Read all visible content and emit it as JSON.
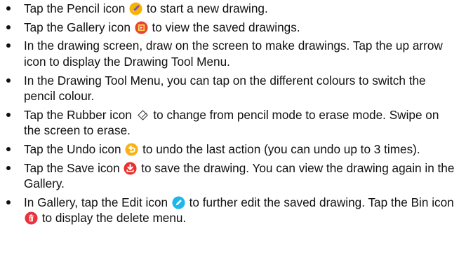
{
  "items": [
    {
      "before": "Tap the Pencil icon",
      "icon": "pencil-icon",
      "after": "to start a new drawing."
    },
    {
      "before": "Tap the Gallery icon",
      "icon": "gallery-icon",
      "after": "to view the saved drawings."
    },
    {
      "text": "In the drawing screen, draw on the screen to make drawings. Tap the up arrow icon to display the Drawing Tool Menu."
    },
    {
      "text": "In the Drawing Tool Menu, you can tap on the different colours to switch the pencil colour."
    },
    {
      "before": "Tap the Rubber icon",
      "icon": "rubber-icon",
      "after": "to change from pencil mode to erase mode. Swipe on the screen to erase."
    },
    {
      "before": "Tap the Undo icon",
      "icon": "undo-icon",
      "after": "to undo the last action (you can undo up to 3 times)."
    },
    {
      "before": "Tap the Save icon",
      "icon": "save-icon",
      "after": "to save the drawing. You can view the drawing again in the Gallery."
    },
    {
      "before": "In Gallery, tap the Edit icon",
      "icon": "edit-icon",
      "mid": "to further edit the saved drawing. Tap the Bin icon",
      "icon2": "bin-icon",
      "after": "to display the delete menu."
    }
  ],
  "colors": {
    "pencil": "#f5b400",
    "gallery": "#e8432f",
    "rubber": "#333333",
    "undo": "#f7b21a",
    "save": "#e8322f",
    "edit": "#1fb6e8",
    "bin": "#e8323c"
  }
}
